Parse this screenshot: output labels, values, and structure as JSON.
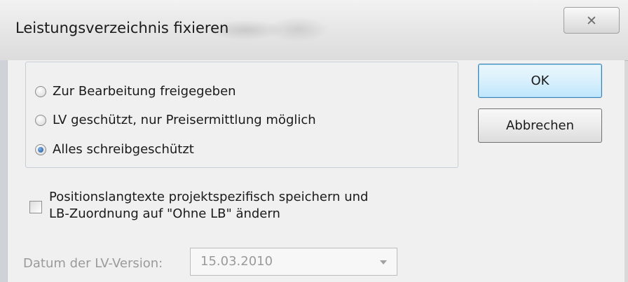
{
  "window": {
    "title": "Leistungsverzeichnis fixieren",
    "close_glyph": "✕"
  },
  "options": {
    "radio1": {
      "label": "Zur Bearbeitung freigegeben",
      "checked": false
    },
    "radio2": {
      "label": "LV geschützt, nur Preisermittlung möglich",
      "checked": false
    },
    "radio3": {
      "label": "Alles schreibgeschützt",
      "checked": true
    }
  },
  "buttons": {
    "ok_label": "OK",
    "cancel_label": "Abbrechen"
  },
  "checkbox": {
    "line1": "Positionslangtexte projektspezifisch speichern und",
    "line2": "LB-Zuordnung auf \"Ohne LB\" ändern",
    "checked": false
  },
  "date": {
    "label": "Datum der LV-Version:",
    "value": "15.03.2010"
  },
  "colors": {
    "accent_radio": "#1f4f96",
    "default_button_border": "#3c7fb1",
    "disabled_text": "#9a9a9a"
  }
}
